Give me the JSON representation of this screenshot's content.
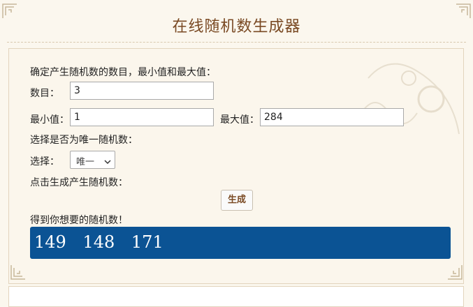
{
  "page": {
    "title": "在线随机数生成器"
  },
  "form": {
    "intro": "确定产生随机数的数目，最小值和最大值：",
    "count_label": "数目：",
    "count_value": "3",
    "min_label": "最小值：",
    "min_value": "1",
    "max_label": "最大值：",
    "max_value": "284",
    "unique_prompt": "选择是否为唯一随机数：",
    "select_label": "选择：",
    "select_value": "唯一",
    "generate_prompt": "点击生成产生随机数：",
    "generate_button": "生成"
  },
  "result": {
    "label": "得到你想要的随机数！",
    "numbers": [
      "149",
      "148",
      "171"
    ],
    "background_color": "#0b5394"
  },
  "colors": {
    "title": "#7a4a24",
    "page_background": "#fbf7ee",
    "panel_border": "#e2d4bd"
  },
  "icons": {
    "select_chevron": "chevron-down-icon",
    "decoration": "number-pattern-decoration"
  }
}
